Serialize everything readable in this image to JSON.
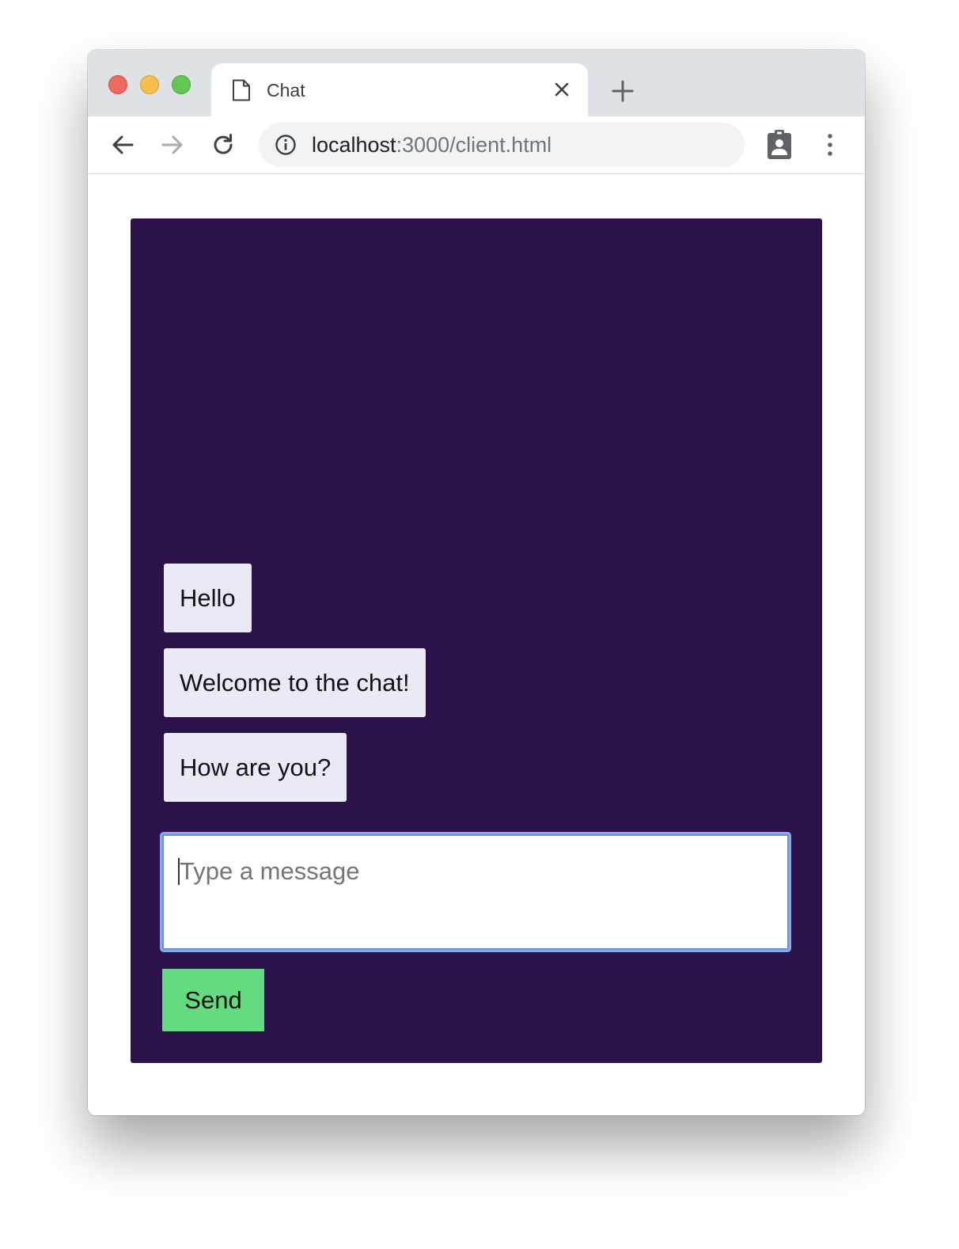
{
  "browser": {
    "tab": {
      "title": "Chat"
    },
    "address": {
      "host": "localhost",
      "path": ":3000/client.html"
    }
  },
  "chat": {
    "messages": [
      "Hello",
      "Welcome to the chat!",
      "How are you?"
    ],
    "input": {
      "placeholder": "Type a message",
      "value": ""
    },
    "send_label": "Send"
  },
  "colors": {
    "panel_background": "#2c124b",
    "message_bubble": "#e9eaf6",
    "send_button": "#63db7e",
    "input_focus_ring": "#88a9ee"
  },
  "icons": {
    "tab": "document-icon",
    "tab_close": "close-icon",
    "new_tab": "plus-icon",
    "back": "arrow-left-icon",
    "forward": "arrow-right-icon",
    "reload": "reload-icon",
    "site_info": "info-icon",
    "profile": "profile-badge-icon",
    "menu": "more-vertical-icon"
  }
}
